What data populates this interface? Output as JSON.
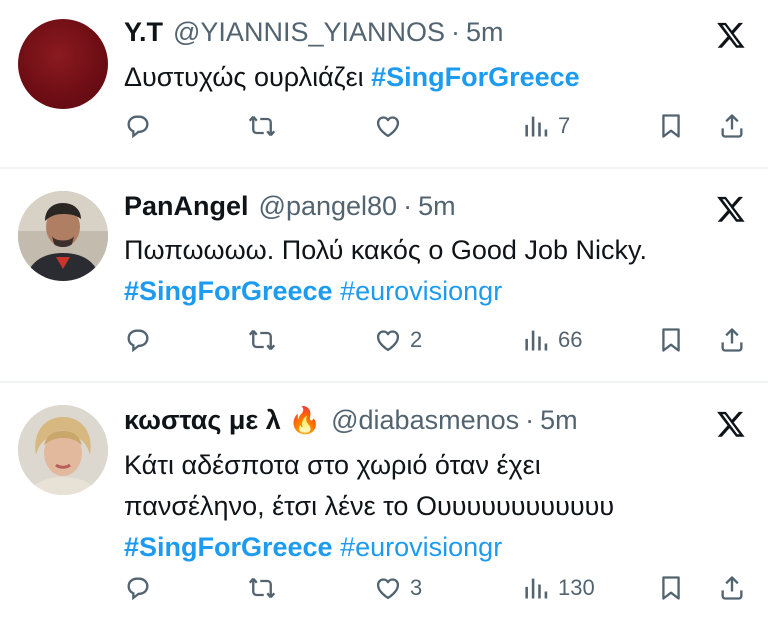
{
  "tweets": [
    {
      "name": "Y.T",
      "handle": "@YIANNIS_YIANNOS",
      "sep": "·",
      "time": "5m",
      "body": {
        "text": "Δυστυχώς ουρλιάζει ",
        "hashtag": "#SingForGreece"
      },
      "stats": {
        "likes": "",
        "views": "7"
      }
    },
    {
      "name": "PanAngel",
      "handle": "@pangel80",
      "sep": "·",
      "time": "5m",
      "body": {
        "text": "Πωπωωωω. Πολύ κακός ο Good Job Nicky.",
        "hashtag": "#SingForGreece",
        "hashtag2": "#eurovisiongr"
      },
      "stats": {
        "likes": "2",
        "views": "66"
      }
    },
    {
      "name": "κωστας με λ",
      "emoji": "🔥",
      "handle": "@diabasmenos",
      "sep": "·",
      "time": "5m",
      "body": {
        "line1": "Κάτι αδέσποτα στο χωριό όταν έχει",
        "line2": "πανσέληνο, έτσι λένε το Ουυυυυυυυυυυυ",
        "hashtag": "#SingForGreece",
        "hashtag2": "#eurovisiongr"
      },
      "stats": {
        "likes": "3",
        "views": "130"
      }
    }
  ],
  "colors": {
    "text": "#0f1419",
    "secondary": "#536471",
    "link": "#1d9bf0",
    "divider": "#eff3f4"
  },
  "icons": [
    "reply-icon",
    "retweet-icon",
    "like-icon",
    "views-icon",
    "bookmark-icon",
    "share-icon",
    "x-logo-icon"
  ]
}
